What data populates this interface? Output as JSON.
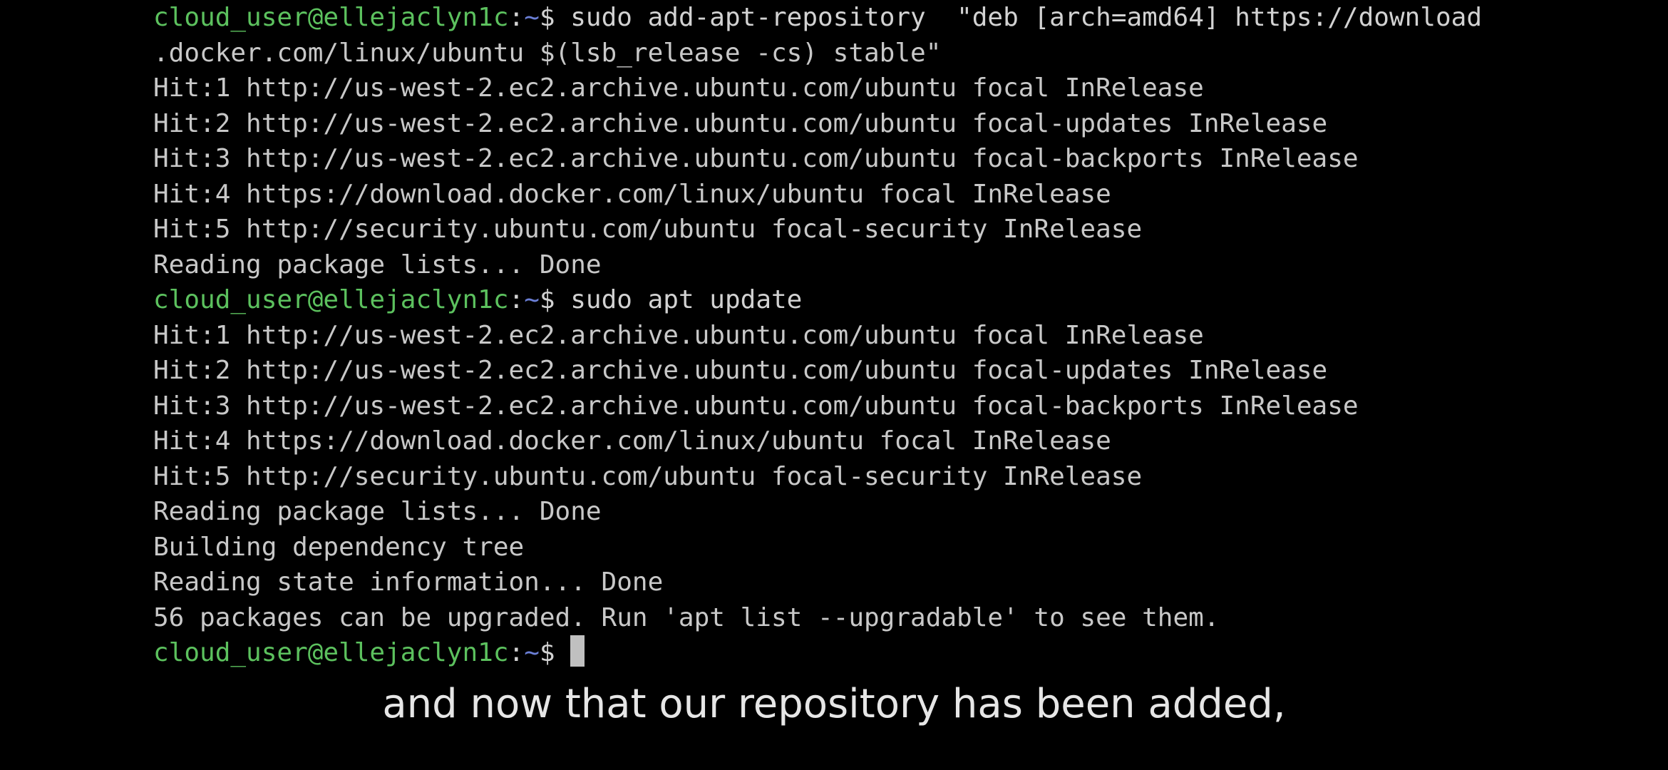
{
  "terminal": {
    "prompt": {
      "user_host": "cloud_user@ellejaclyn1c",
      "colon": ":",
      "path": "~",
      "symbol": "$ "
    },
    "lines": [
      {
        "type": "prompt",
        "command": "sudo add-apt-repository  \"deb [arch=amd64] https://download"
      },
      {
        "type": "output",
        "text": ".docker.com/linux/ubuntu $(lsb_release -cs) stable\""
      },
      {
        "type": "output",
        "text": "Hit:1 http://us-west-2.ec2.archive.ubuntu.com/ubuntu focal InRelease"
      },
      {
        "type": "output",
        "text": "Hit:2 http://us-west-2.ec2.archive.ubuntu.com/ubuntu focal-updates InRelease"
      },
      {
        "type": "output",
        "text": "Hit:3 http://us-west-2.ec2.archive.ubuntu.com/ubuntu focal-backports InRelease"
      },
      {
        "type": "output",
        "text": "Hit:4 https://download.docker.com/linux/ubuntu focal InRelease"
      },
      {
        "type": "output",
        "text": "Hit:5 http://security.ubuntu.com/ubuntu focal-security InRelease"
      },
      {
        "type": "output",
        "text": "Reading package lists... Done"
      },
      {
        "type": "prompt",
        "command": "sudo apt update"
      },
      {
        "type": "output",
        "text": "Hit:1 http://us-west-2.ec2.archive.ubuntu.com/ubuntu focal InRelease"
      },
      {
        "type": "output",
        "text": "Hit:2 http://us-west-2.ec2.archive.ubuntu.com/ubuntu focal-updates InRelease"
      },
      {
        "type": "output",
        "text": "Hit:3 http://us-west-2.ec2.archive.ubuntu.com/ubuntu focal-backports InRelease"
      },
      {
        "type": "output",
        "text": "Hit:4 https://download.docker.com/linux/ubuntu focal InRelease"
      },
      {
        "type": "output",
        "text": "Hit:5 http://security.ubuntu.com/ubuntu focal-security InRelease"
      },
      {
        "type": "output",
        "text": "Reading package lists... Done"
      },
      {
        "type": "output",
        "text": "Building dependency tree"
      },
      {
        "type": "output",
        "text": "Reading state information... Done"
      },
      {
        "type": "output",
        "text": "56 packages can be upgraded. Run 'apt list --upgradable' to see them."
      },
      {
        "type": "prompt",
        "command": "",
        "cursor": true
      }
    ]
  },
  "caption": {
    "text": "and now that our repository has been added,"
  },
  "colors": {
    "background": "#000000",
    "output_text": "#c8c8c8",
    "prompt_user": "#5cc15e",
    "prompt_path": "#6b7fd6",
    "cursor": "#c0c0c0"
  }
}
